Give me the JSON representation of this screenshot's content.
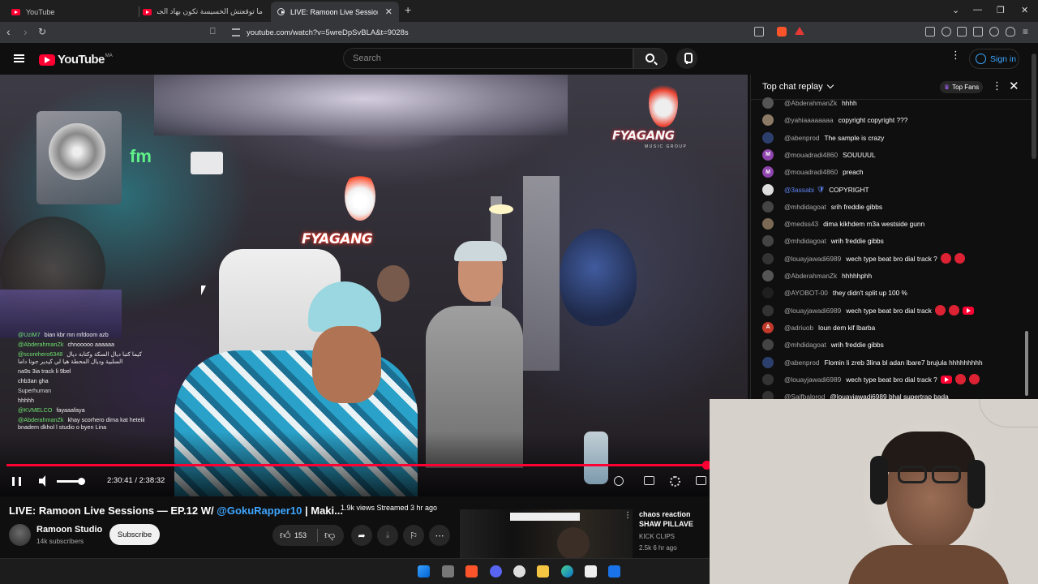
{
  "browser": {
    "tabs": [
      {
        "title": "YouTube"
      },
      {
        "title": "ما توقعتش الخسيسة تكون بهاد الجمال |"
      },
      {
        "title": "LIVE: Ramoon Live Sessions —"
      }
    ],
    "url": "youtube.com/watch?v=5wreDpSvBLA&t=9028s"
  },
  "youtube": {
    "logo_text": "YouTube",
    "country_code": "MA",
    "search_placeholder": "Search",
    "sign_in_label": "Sign in"
  },
  "video": {
    "banner_text": "FYAGANG",
    "banner_corner_text": "FYAGANG",
    "banner_corner_sub": "MUSIC GROUP",
    "time_display": "2:30:41 / 2:38:32",
    "progress_fraction": 0.95,
    "volume_fraction": 0.95,
    "overlay_chat": [
      {
        "user": "@UziM7",
        "text": "bian kbr mn mfdoom azb"
      },
      {
        "user": "@AbderahmanZk",
        "text": "chnooooo aaaaaa"
      },
      {
        "user": "@scorehero6348",
        "text": "كيما كتبا ديال السكة وكتابة ديال السلبية وديال المحطة هيا لي كيدير جونا داما"
      },
      {
        "user": "",
        "text": "na9s 3ia track li 9bel"
      },
      {
        "user": "",
        "text": "chb3an gha"
      },
      {
        "user": "Superhuman",
        "text": ""
      },
      {
        "user": "",
        "text": "hhhhh"
      },
      {
        "user": "@KVMELCO",
        "text": "fayaaafaya"
      },
      {
        "user": "@AbderahmanZk",
        "text": "khay scorhero dima kat heteiii bnadem dkhol l studio o byen Lina"
      }
    ]
  },
  "chat": {
    "title": "Top chat replay",
    "top_fans_label": "Top Fans",
    "messages": [
      {
        "author": "@AbderahmanZk",
        "text": "hhhh",
        "avatar_color": "#555555",
        "mod": false
      },
      {
        "author": "@yahiaaaaaaaa",
        "text": "copyright copyright ???",
        "avatar_color": "#8b7a66",
        "mod": false
      },
      {
        "author": "@abenprod",
        "text": "The sample is crazy",
        "avatar_color": "#2c3e6b",
        "mod": false
      },
      {
        "author": "@mouadradi4860",
        "text": "SOUUUUL",
        "avatar_color": "#8e44ad",
        "mod": false,
        "initial": "M"
      },
      {
        "author": "@mouadradi4860",
        "text": "preach",
        "avatar_color": "#8e44ad",
        "mod": false,
        "initial": "M"
      },
      {
        "author": "@3assabi",
        "text": "COPYRIGHT",
        "avatar_color": "#dddddd",
        "mod": true
      },
      {
        "author": "@mhdidagoat",
        "text": "srih freddie gibbs",
        "avatar_color": "#444444",
        "mod": false
      },
      {
        "author": "@medss43",
        "text": "dima kikhdem m3a westside gunn",
        "avatar_color": "#7a6a55",
        "mod": false
      },
      {
        "author": "@mhdidagoat",
        "text": "wrih freddie gibbs",
        "avatar_color": "#444444",
        "mod": false
      },
      {
        "author": "@louayjawadi6989",
        "text": "wech type beat bro dial track ?",
        "avatar_color": "#333333",
        "mod": false,
        "emoji": "two"
      },
      {
        "author": "@AbderahmanZk",
        "text": "hhhhhphh",
        "avatar_color": "#555555",
        "mod": false
      },
      {
        "author": "@AYOBOT-00",
        "text": "they didn't split up 100 %",
        "avatar_color": "#1f1f1f",
        "mod": false
      },
      {
        "author": "@louayjawadi6989",
        "text": "wech type beat bro dial track",
        "avatar_color": "#333333",
        "mod": false,
        "emoji": "three"
      },
      {
        "author": "@adriuob",
        "text": "loun dem kif lbarba",
        "avatar_color": "#c0392b",
        "mod": false,
        "initial": "A"
      },
      {
        "author": "@mhdidagoat",
        "text": "wrih freddie gibbs",
        "avatar_color": "#444444",
        "mod": false
      },
      {
        "author": "@abenprod",
        "text": "Flomin li zreb 3lina bl adan lbare7 brujula hhhhhhhhh",
        "avatar_color": "#2c3e6b",
        "mod": false
      },
      {
        "author": "@louayjawadi6989",
        "text": "wech type beat bro dial track ?",
        "avatar_color": "#333333",
        "mod": false,
        "emoji": "four"
      },
      {
        "author": "@Saifbalorod",
        "text": "@louayjawadi6989 bhal supertrap bada",
        "avatar_color": "#333333",
        "mod": false
      }
    ]
  },
  "below": {
    "title_prefix": "LIVE: Ramoon Live Sessions — EP.12 W/ ",
    "title_tag": "@GokuRapper10",
    "title_suffix": " | Maki...",
    "stats": "1.9k views  Streamed 3 hr ago",
    "channel_name": "Ramoon Studio",
    "subscribers": "14k subscribers",
    "subscribe_label": "Subscribe",
    "like_count": "153"
  },
  "recommended": {
    "title": "chaos reaction SHAW PILLAVE",
    "channel": "KICK CLIPS",
    "meta": "2.5k  6 hr ago"
  },
  "colors": {
    "accent_red": "#ff0033",
    "link_blue": "#3ea6ff"
  }
}
